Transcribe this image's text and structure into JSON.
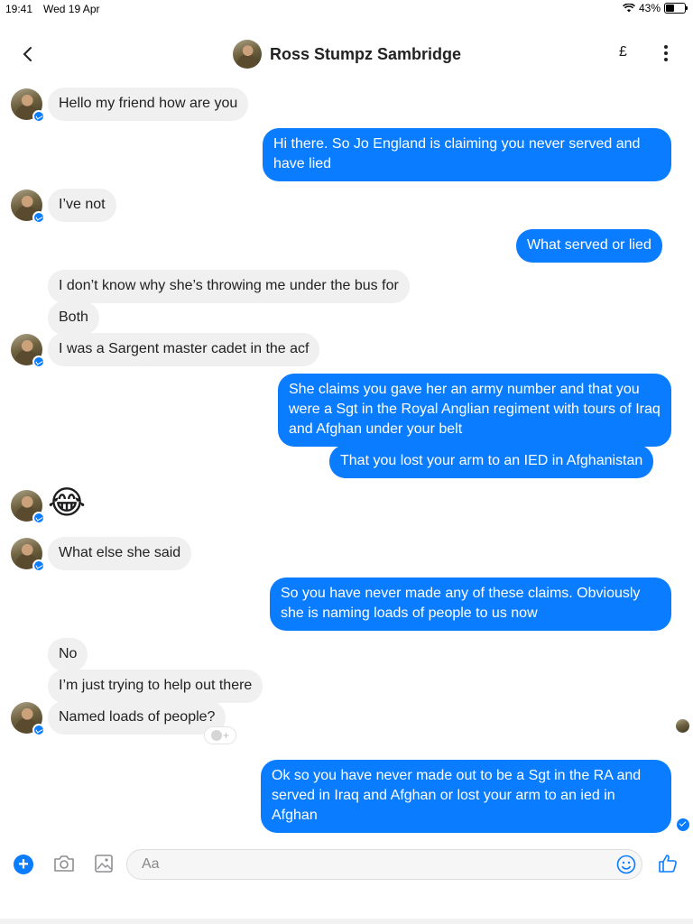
{
  "status": {
    "time": "19:41",
    "date": "Wed 19 Apr",
    "battery": "43%"
  },
  "header": {
    "title": "Ross Stumpz Sambridge",
    "currency": "£"
  },
  "messages": [
    {
      "side": "in",
      "text": "Hello my friend how are you"
    },
    {
      "side": "out",
      "text": "Hi there. So Jo England is claiming you never served and have lied"
    },
    {
      "side": "in",
      "text": "I’ve not"
    },
    {
      "side": "out",
      "text": "What served or lied"
    },
    {
      "side": "in",
      "text": "I don’t know why she’s throwing me under the bus for"
    },
    {
      "side": "in",
      "text": "Both"
    },
    {
      "side": "in",
      "text": "I was a Sargent master cadet in the acf"
    },
    {
      "side": "out",
      "text": "She claims you gave her an army number and that you were a Sgt in the Royal Anglian regiment with tours of Iraq and Afghan under your belt"
    },
    {
      "side": "out",
      "text": "That you lost your arm to an IED in Afghanistan"
    },
    {
      "side": "in",
      "text": "😂"
    },
    {
      "side": "in",
      "text": "What else she said"
    },
    {
      "side": "out",
      "text": "So you have never made any of these claims. Obviously she is naming loads of people to us now"
    },
    {
      "side": "in",
      "text": "No"
    },
    {
      "side": "in",
      "text": "I’m just trying to help out there"
    },
    {
      "side": "in",
      "text": "Named loads of people?"
    },
    {
      "side": "out",
      "text": "Ok so you have never made out to be a Sgt in the RA and served in Iraq and Afghan or lost your arm to an ied in Afghan"
    }
  ],
  "composer": {
    "placeholder": "Aa"
  },
  "colors": {
    "accent": "#0a7cff",
    "incoming": "#f0f0f0"
  }
}
